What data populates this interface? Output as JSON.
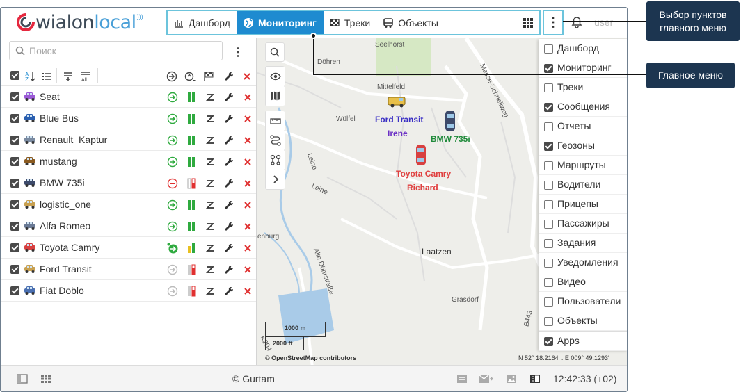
{
  "header": {
    "logo_part1": "wialon",
    "logo_part2": "local",
    "menu": [
      {
        "label": "Дашборд",
        "icon": "dashboard-icon",
        "active": false
      },
      {
        "label": "Мониторинг",
        "icon": "globe-icon",
        "active": true
      },
      {
        "label": "Треки",
        "icon": "flag-icon",
        "active": false
      },
      {
        "label": "Объекты",
        "icon": "bus-icon",
        "active": false
      }
    ],
    "more_label": "⋮",
    "user": "user"
  },
  "search": {
    "placeholder": "Поиск"
  },
  "units": [
    {
      "name": "Seat",
      "checked": true,
      "status": "ok"
    },
    {
      "name": "Blue Bus",
      "checked": true,
      "status": "ok"
    },
    {
      "name": "Renault_Kaptur",
      "checked": true,
      "status": "ok"
    },
    {
      "name": "mustang",
      "checked": true,
      "status": "ok"
    },
    {
      "name": "BMW 735i",
      "checked": true,
      "status": "stop"
    },
    {
      "name": "logistic_one",
      "checked": true,
      "status": "ok"
    },
    {
      "name": "Alfa Romeo",
      "checked": true,
      "status": "ok"
    },
    {
      "name": "Toyota Camry",
      "checked": true,
      "status": "moving"
    },
    {
      "name": "Ford Transit",
      "checked": true,
      "status": "idle"
    },
    {
      "name": "Fiat Doblo",
      "checked": true,
      "status": "idle"
    }
  ],
  "map": {
    "labels": [
      {
        "text": "Ford Transit",
        "color": "#3a2fc4"
      },
      {
        "text": "Irene",
        "color": "#6a2fc4"
      },
      {
        "text": "BMW 735i",
        "color": "#1f8a3a"
      },
      {
        "text": "Toyota Camry",
        "color": "#e04040"
      },
      {
        "text": "Richard",
        "color": "#e04040"
      }
    ],
    "places": [
      "Seelhorst",
      "Döhren",
      "Mittelfeld",
      "Wülfel",
      "Leine",
      "Leine",
      "Laatzen",
      "Grasdorf",
      "Alte Döhrstraße",
      "Messe-Schnellweg",
      "enburg",
      "B443",
      "K204"
    ],
    "scale_m": "1000 m",
    "scale_ft": "2000 ft",
    "attribution": "© OpenStreetMap contributors",
    "coords": "N 52° 18.2164' : E 009° 49.1293'"
  },
  "dropdown": [
    {
      "label": "Дашборд",
      "checked": false
    },
    {
      "label": "Мониторинг",
      "checked": true
    },
    {
      "label": "Треки",
      "checked": false
    },
    {
      "label": "Сообщения",
      "checked": true
    },
    {
      "label": "Отчеты",
      "checked": false
    },
    {
      "label": "Геозоны",
      "checked": true
    },
    {
      "label": "Маршруты",
      "checked": false
    },
    {
      "label": "Водители",
      "checked": false
    },
    {
      "label": "Прицепы",
      "checked": false
    },
    {
      "label": "Пассажиры",
      "checked": false
    },
    {
      "label": "Задания",
      "checked": false
    },
    {
      "label": "Уведомления",
      "checked": false
    },
    {
      "label": "Видео",
      "checked": false
    },
    {
      "label": "Пользователи",
      "checked": false
    },
    {
      "label": "Объекты",
      "checked": false
    },
    {
      "label": "Apps",
      "checked": true
    }
  ],
  "footer": {
    "copyright": "© Gurtam",
    "clock": "12:42:33 (+02)"
  },
  "callouts": {
    "menu_items_select": "Выбор пунктов главного меню",
    "main_menu": "Главное меню"
  },
  "colors": {
    "accent": "#1e8bd0",
    "callout_bg": "#1c3550",
    "highlight_border": "#6cc4dc",
    "green": "#2faa3f",
    "red": "#e03030"
  }
}
